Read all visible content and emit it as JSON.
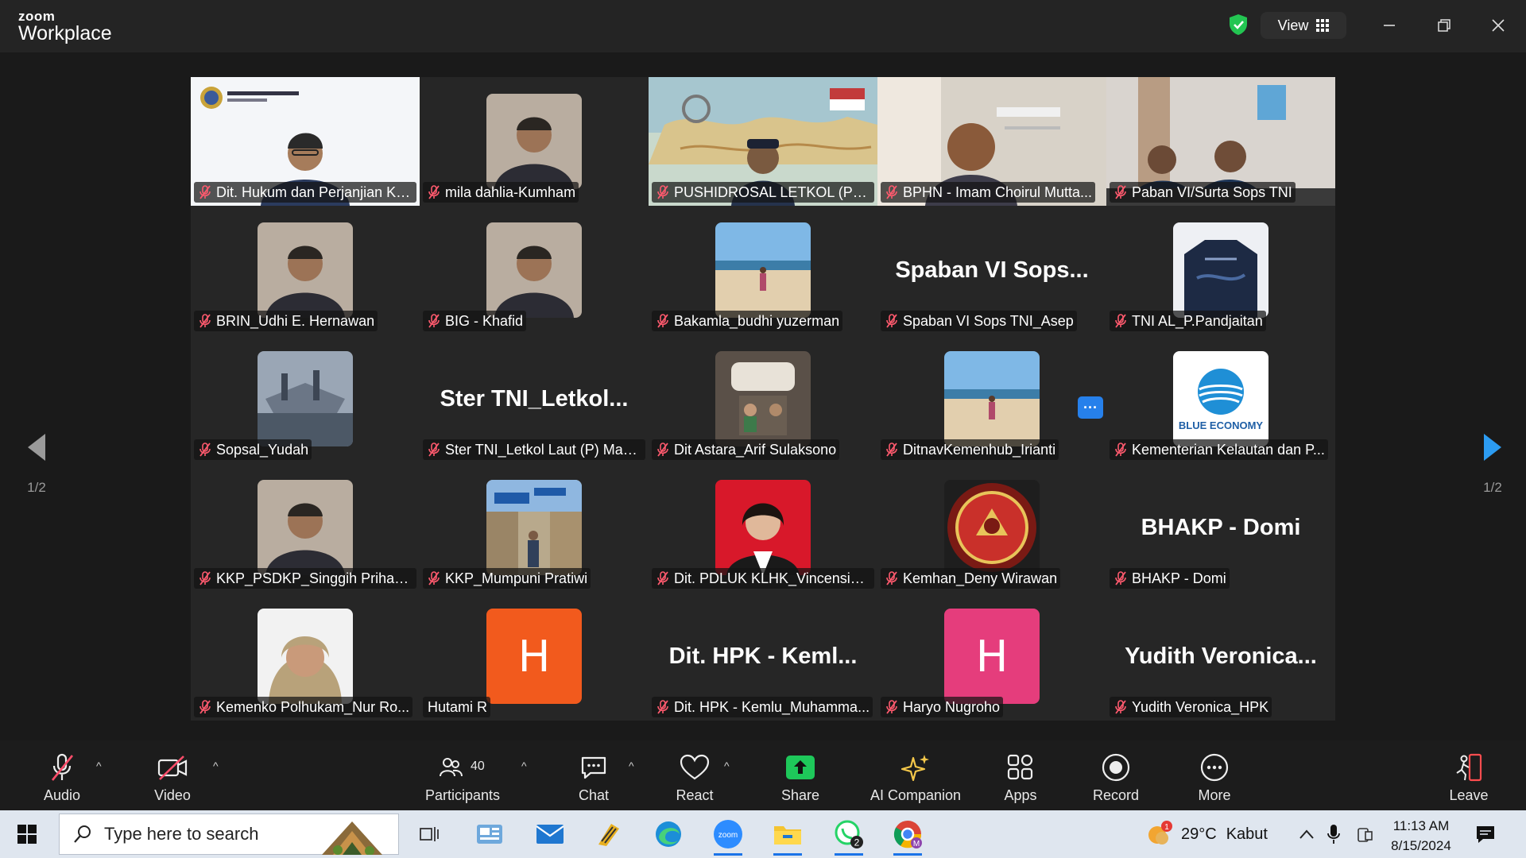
{
  "app": {
    "brand_top": "zoom",
    "brand_bottom": "Workplace",
    "view_label": "View"
  },
  "colors": {
    "active_speaker": "#23d959",
    "share_green": "#1ec85a",
    "accent_blue": "#2680eb"
  },
  "pager": {
    "left": "1/2",
    "right": "1/2"
  },
  "participants": [
    {
      "name": "Dit. Hukum dan Perjanjian Kewi...",
      "kind": "video-slide",
      "active": true
    },
    {
      "name": "mila dahlia-Kumham",
      "kind": "thumb-photo"
    },
    {
      "name": "PUSHIDROSAL LETKOL (P) Y...",
      "kind": "video-map"
    },
    {
      "name": "BPHN - Imam Choirul Mutta...",
      "kind": "video-room"
    },
    {
      "name": "Paban VI/Surta Sops TNI",
      "kind": "video-office"
    },
    {
      "name": "BRIN_Udhi E. Hernawan",
      "kind": "thumb-photo"
    },
    {
      "name": "BIG - Khafid",
      "kind": "thumb-photo"
    },
    {
      "name": "Bakamla_budhi yuzerman",
      "kind": "thumb-beach"
    },
    {
      "name": "Spaban VI Sops TNI_Asep",
      "kind": "text",
      "big": "Spaban VI Sops..."
    },
    {
      "name": "TNI AL_P.Pandjaitan",
      "kind": "thumb-shirt"
    },
    {
      "name": "Sopsal_Yudah",
      "kind": "thumb-ship"
    },
    {
      "name": "Ster TNI_Letkol Laut (P) Mah...",
      "kind": "text",
      "big": "Ster  TNI_Letkol..."
    },
    {
      "name": "Dit Astara_Arif Sulaksono",
      "kind": "thumb-train"
    },
    {
      "name": "DitnavKemenhub_Irianti",
      "kind": "thumb-beach"
    },
    {
      "name": "Kementerian Kelautan dan P...",
      "kind": "thumb-logo",
      "logo_text": "BLUE ECONOMY"
    },
    {
      "name": "KKP_PSDKP_Singgih Prihadi ...",
      "kind": "thumb-photo"
    },
    {
      "name": "KKP_Mumpuni Pratiwi",
      "kind": "thumb-street"
    },
    {
      "name": "Dit. PDLUK KLHK_Vincensia ...",
      "kind": "thumb-red"
    },
    {
      "name": "Kemhan_Deny Wirawan",
      "kind": "thumb-seal"
    },
    {
      "name": "BHAKP - Domi",
      "kind": "text",
      "big": "BHAKP - Domi"
    },
    {
      "name": "Kemenko Polhukam_Nur Ro...",
      "kind": "thumb-hijab"
    },
    {
      "name": "Hutami R",
      "kind": "letter",
      "letter": "H",
      "color": "#f25a1d",
      "muted": false
    },
    {
      "name": "Dit. HPK - Kemlu_Muhamma...",
      "kind": "text",
      "big": "Dit. HPK - Keml..."
    },
    {
      "name": "Haryo Nugroho",
      "kind": "letter",
      "letter": "H",
      "color": "#e53d7c"
    },
    {
      "name": "Yudith Veronica_HPK",
      "kind": "text",
      "big": "Yudith  Veronica..."
    }
  ],
  "toolbar": {
    "audio": "Audio",
    "video": "Video",
    "participants": "Participants",
    "participants_count": "40",
    "chat": "Chat",
    "react": "React",
    "share": "Share",
    "ai_companion": "AI Companion",
    "apps": "Apps",
    "record": "Record",
    "more": "More",
    "leave": "Leave"
  },
  "taskbar": {
    "search_placeholder": "Type here to search",
    "weather_temp": "29°C",
    "weather_desc": "Kabut",
    "time": "11:13 AM",
    "date": "8/15/2024",
    "whatsapp_badge": "2",
    "weather_alert": "1"
  }
}
